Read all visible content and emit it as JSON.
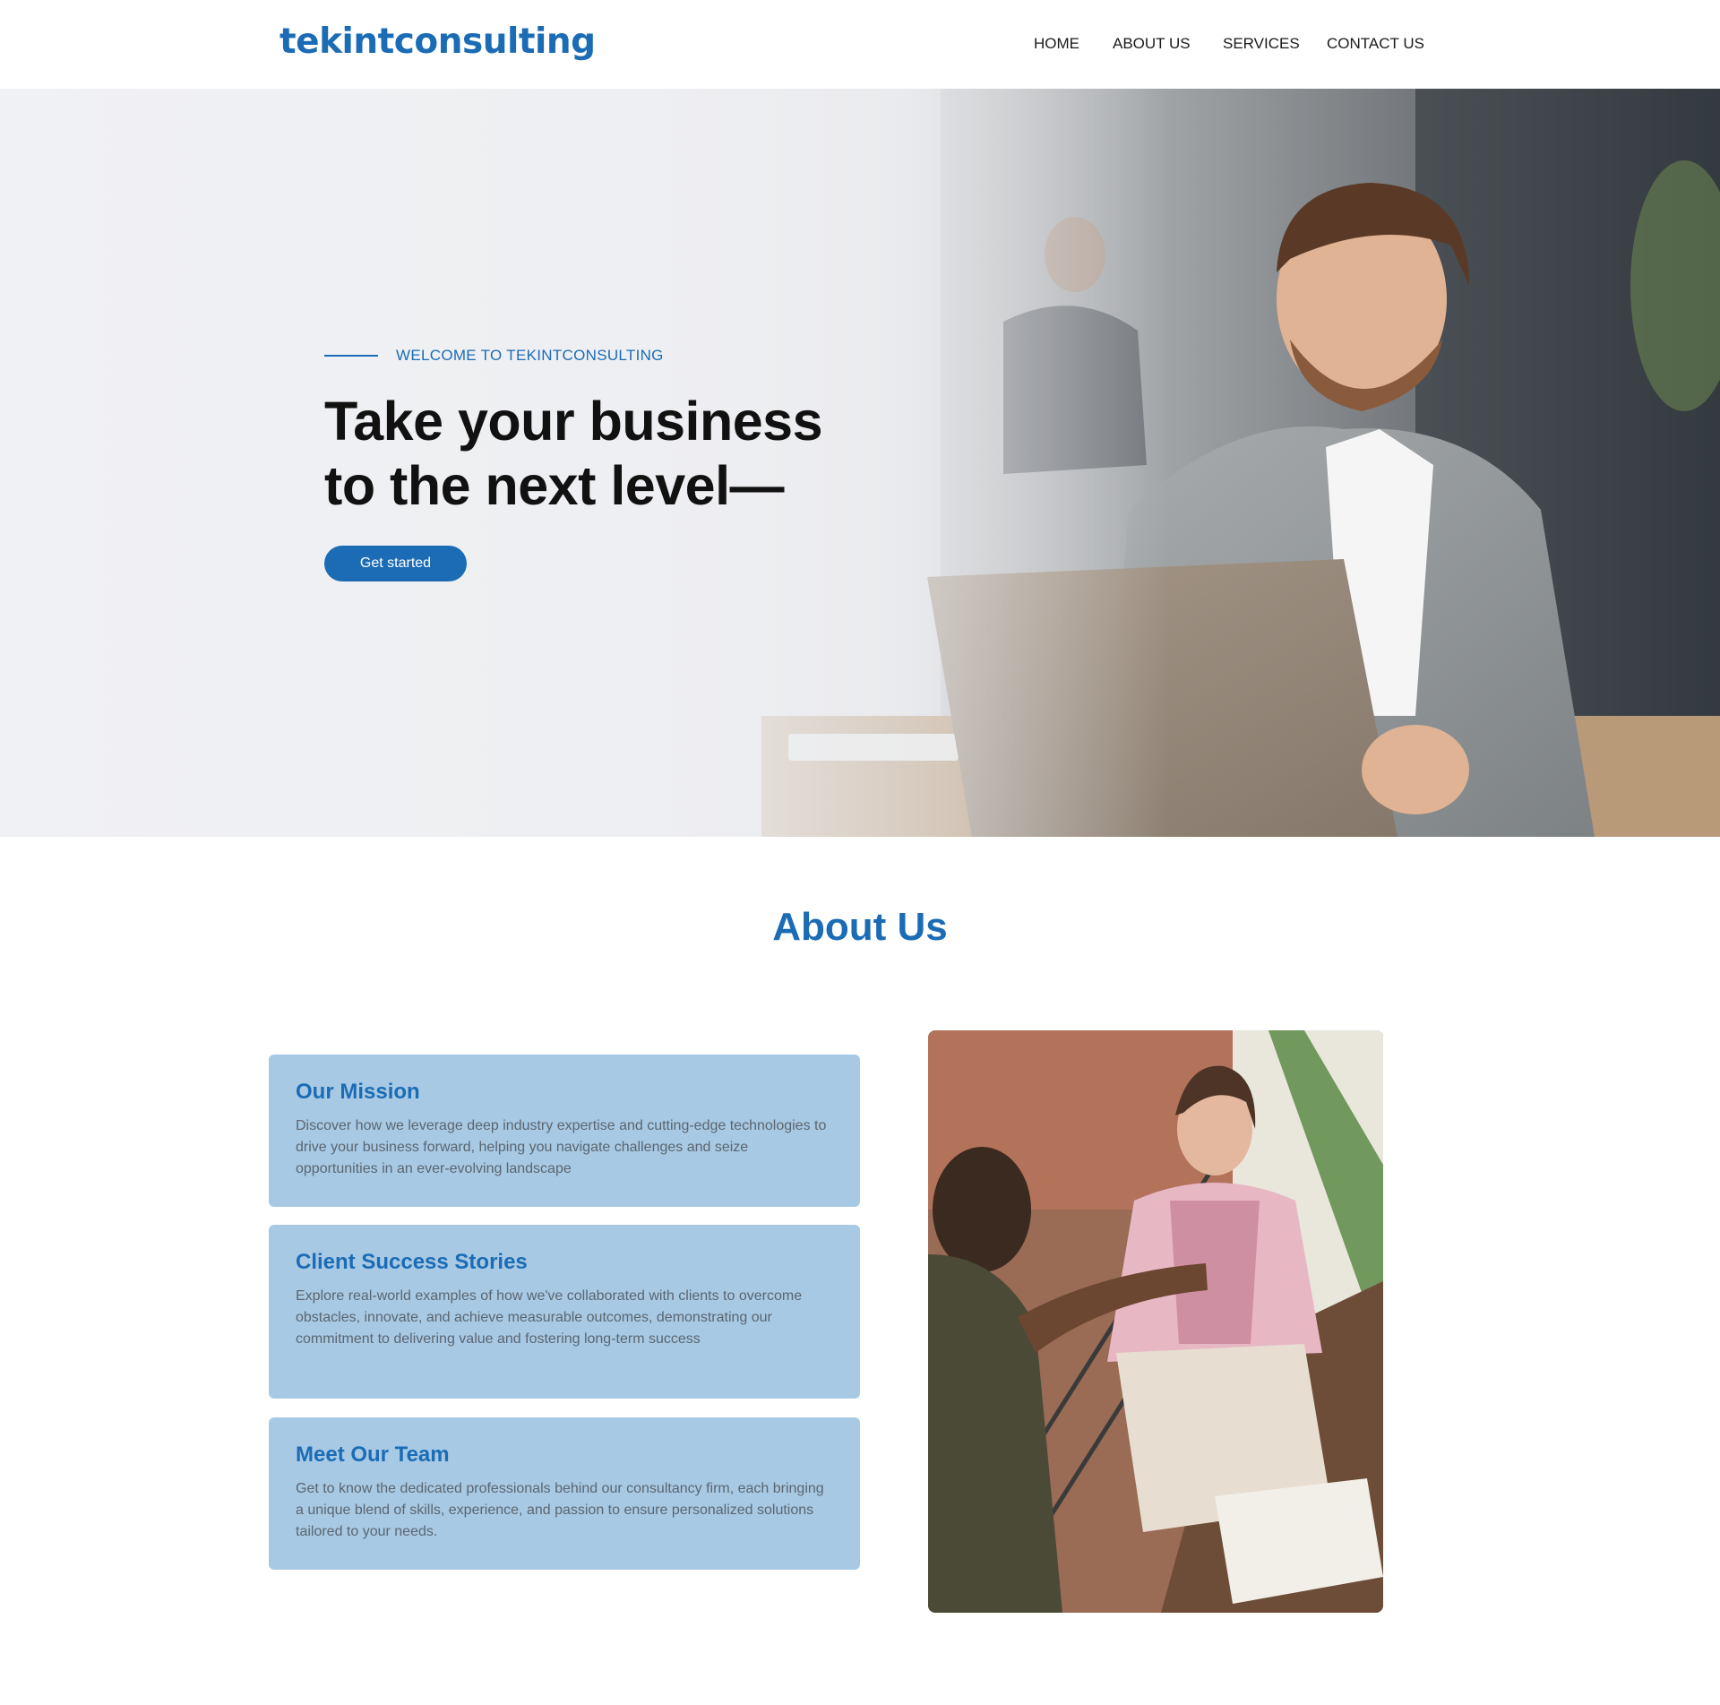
{
  "header": {
    "logo": "tekintconsulting",
    "nav": [
      "HOME",
      "ABOUT US",
      "SERVICES",
      "CONTACT US"
    ]
  },
  "hero": {
    "eyebrow": "WELCOME TO TEKINTCONSULTING",
    "title_line1": "Take your business",
    "title_line2": "to the next level—",
    "cta_label": "Get started"
  },
  "about": {
    "title": "About Us",
    "cards": [
      {
        "title": "Our Mission",
        "text": "Discover how we leverage deep industry expertise and cutting-edge technologies to drive your business forward, helping you navigate challenges and seize opportunities in an ever-evolving landscape"
      },
      {
        "title": "Client Success Stories",
        "text": "Explore real-world examples of how we've collaborated with clients to overcome obstacles, innovate, and achieve measurable outcomes, demonstrating our commitment to delivering value and fostering long-term success"
      },
      {
        "title": "Meet Our Team",
        "text": "Get to know the dedicated professionals behind our consultancy firm, each bringing a unique blend of skills, experience, and passion to ensure personalized solutions tailored to your needs."
      }
    ]
  },
  "colors": {
    "brand": "#1b6cb5",
    "card_bg": "#a7c9e4",
    "body_text": "#5b6670"
  }
}
